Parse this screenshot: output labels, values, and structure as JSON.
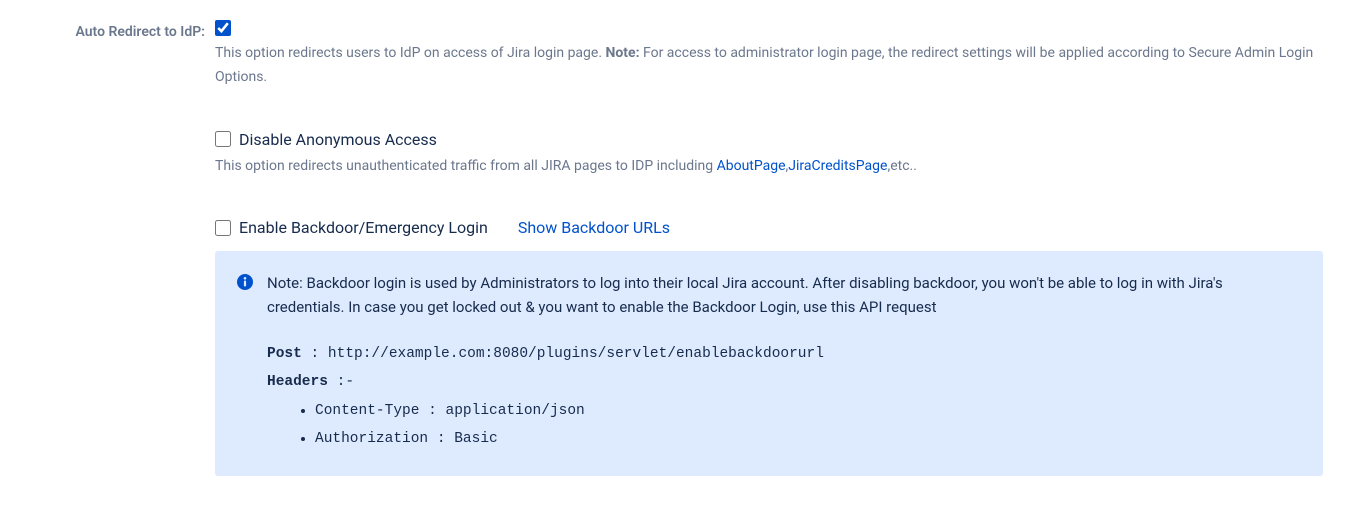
{
  "auto_redirect": {
    "label": "Auto Redirect to IdP:",
    "checked": true,
    "help_pre": "This option redirects users to IdP on access of Jira login page. ",
    "help_note_label": "Note:",
    "help_post": " For access to administrator login page, the redirect settings will be applied according to Secure Admin Login Options."
  },
  "disable_anon": {
    "label": "Disable Anonymous Access",
    "checked": false,
    "help_pre": "This option redirects unauthenticated traffic from all JIRA pages to IDP including ",
    "link1": "AboutPage",
    "sep": ",",
    "link2": "JiraCreditsPage",
    "help_post": ",etc.."
  },
  "backdoor": {
    "label": "Enable Backdoor/Emergency Login",
    "checked": false,
    "show_link": "Show Backdoor URLs",
    "note_text": "Note: Backdoor login is used by Administrators to log into their local Jira account. After disabling backdoor, you won't be able to log in with Jira's credentials. In case you get locked out & you want to enable the Backdoor Login, use this API request",
    "post_label": "Post",
    "post_sep": " : ",
    "post_url": "http://example.com:8080/plugins/servlet/enablebackdoorurl",
    "headers_label": "Headers",
    "headers_sep": " :-",
    "headers": [
      "Content-Type : application/json",
      "Authorization : Basic"
    ]
  }
}
